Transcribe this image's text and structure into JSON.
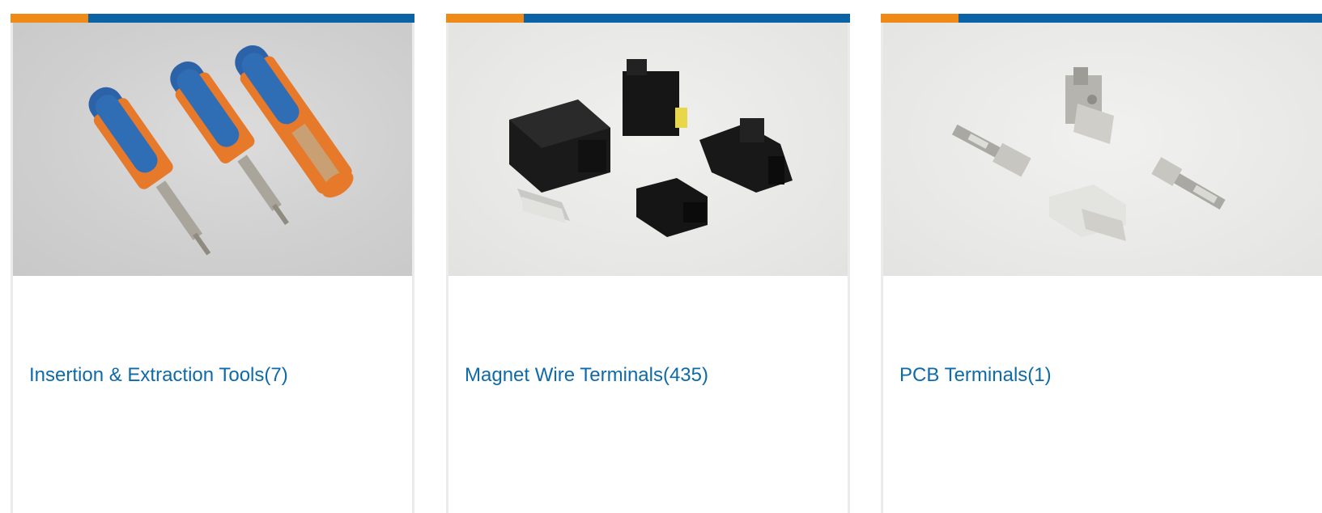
{
  "colors": {
    "accent": "#ef8a17",
    "primary": "#0b63a6",
    "link": "#0e6aa8"
  },
  "cards": [
    {
      "title": "Insertion & Extraction Tools(7)",
      "image_icon": "extraction-tools-photo"
    },
    {
      "title": "Magnet Wire Terminals(435)",
      "image_icon": "connector-housings-photo"
    },
    {
      "title": "PCB Terminals(1)",
      "image_icon": "metal-terminals-photo"
    }
  ]
}
